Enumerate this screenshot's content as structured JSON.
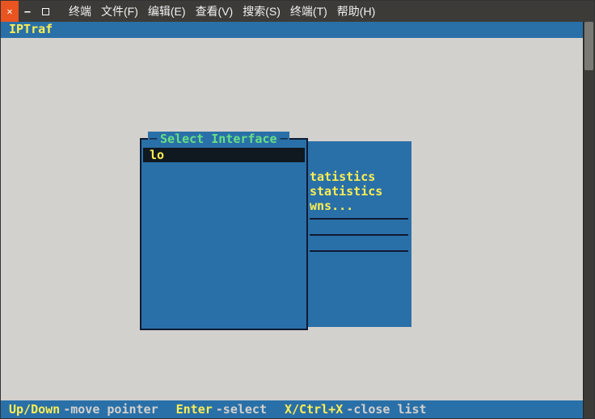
{
  "titlebar": {
    "menus": [
      "终端",
      "文件(F)",
      "编辑(E)",
      "查看(V)",
      "搜索(S)",
      "终端(T)",
      "帮助(H)"
    ]
  },
  "app": {
    "title": "IPTraf"
  },
  "back_panel": {
    "lines": [
      "tatistics",
      "statistics",
      "wns..."
    ]
  },
  "dialog": {
    "title": "Select Interface",
    "items": [
      "lo"
    ],
    "selected_index": 0
  },
  "statusbar": {
    "k1": "Up/Down",
    "t1": "-move pointer",
    "k2": "Enter",
    "t2": "-select",
    "k3": "X/Ctrl+X",
    "t3": "-close list"
  }
}
